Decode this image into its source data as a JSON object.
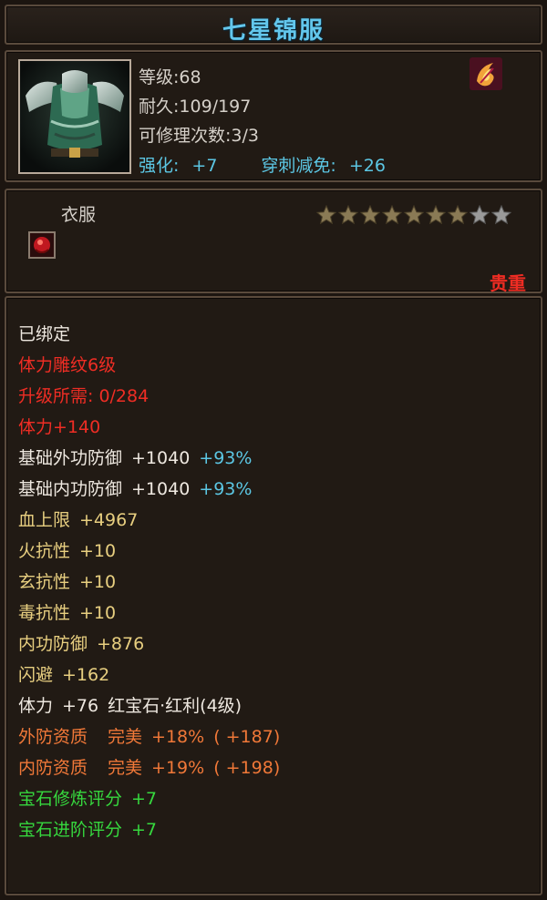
{
  "title": "七星锦服",
  "header": {
    "level": "等级:68",
    "durability": "耐久:109/197",
    "repair": "可修理次数:3/3",
    "enhance_label": "强化:",
    "enhance_value": "+7",
    "pierce_label": "穿刺减免:",
    "pierce_value": "+26"
  },
  "item_type": "衣服",
  "stars": {
    "filled": 7,
    "total": 9
  },
  "rarity": "贵重",
  "attributes": {
    "bound": "已绑定",
    "engrave": "体力雕纹6级",
    "upgrade_need": "升级所需: 0/284",
    "stamina_bonus": "体力+140",
    "base_outer_def": {
      "label": "基础外功防御",
      "value": "+1040",
      "pct": "+93%"
    },
    "base_inner_def": {
      "label": "基础内功防御",
      "value": "+1040",
      "pct": "+93%"
    },
    "hp_max": {
      "label": "血上限",
      "value": "+4967"
    },
    "fire_res": {
      "label": "火抗性",
      "value": "+10"
    },
    "dark_res": {
      "label": "玄抗性",
      "value": "+10"
    },
    "poison_res": {
      "label": "毒抗性",
      "value": "+10"
    },
    "inner_def": {
      "label": "内功防御",
      "value": "+876"
    },
    "dodge": {
      "label": "闪避",
      "value": "+162"
    },
    "gem_line": {
      "label": "体力",
      "value": "+76",
      "gem": "红宝石·红利(4级)"
    },
    "outer_quality": {
      "label": "外防资质",
      "grade": "完美",
      "pct": "+18%",
      "bonus": "( +187)"
    },
    "inner_quality": {
      "label": "内防资质",
      "grade": "完美",
      "pct": "+19%",
      "bonus": "( +198)"
    },
    "gem_refine": {
      "label": "宝石修炼评分",
      "value": "+7"
    },
    "gem_advance": {
      "label": "宝石进阶评分",
      "value": "+7"
    }
  },
  "colors": {
    "title": "#63c7ec",
    "red": "#ef2d24",
    "orange": "#f07838",
    "cyan": "#5cc7e4",
    "green": "#36d83e",
    "star_filled": "#8a7a55",
    "star_empty": "#9a9a9a"
  },
  "icons": {
    "item": "armor-icon",
    "skill": "flame-skill-icon",
    "gem_slot": "ruby-gem-icon",
    "star": "star-icon"
  }
}
